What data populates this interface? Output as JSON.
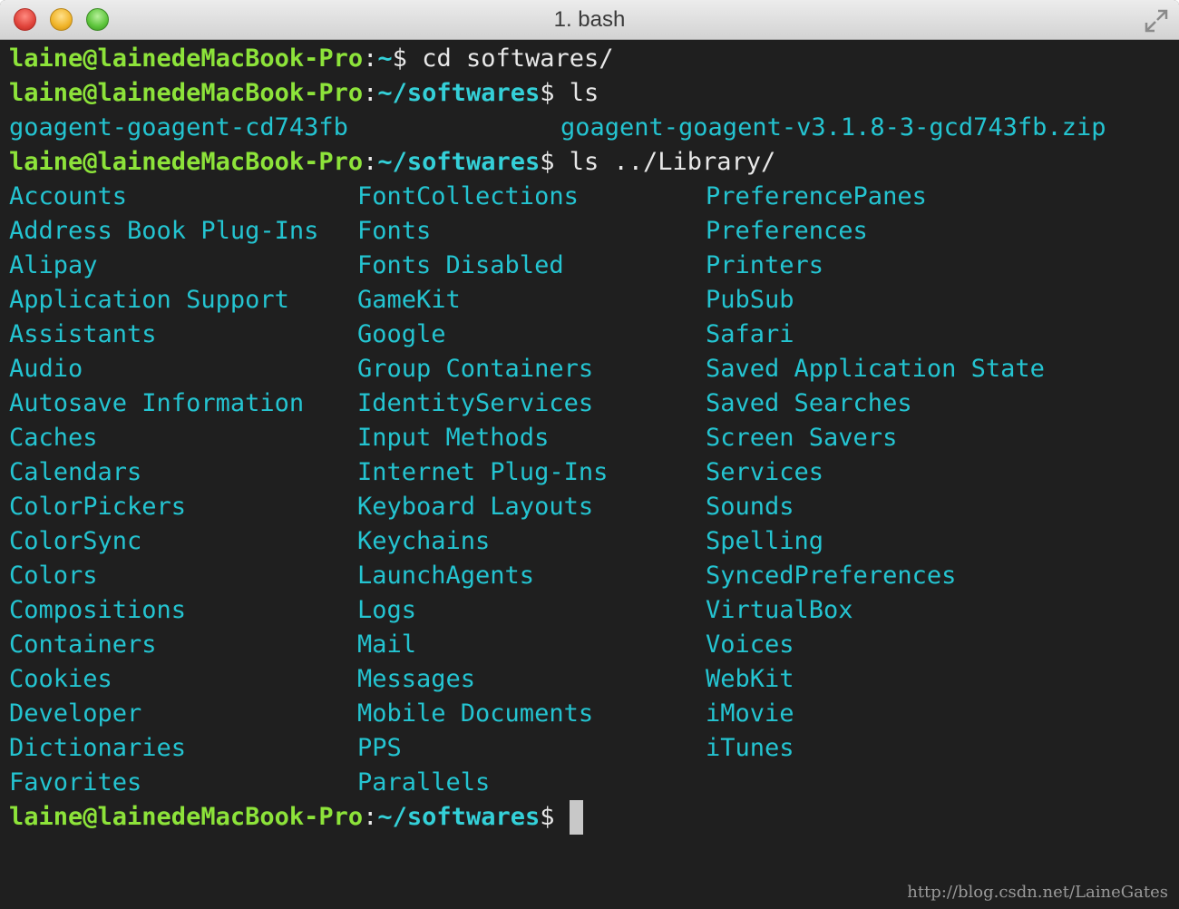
{
  "window": {
    "title": "1. bash"
  },
  "terminal": {
    "prompt_user": "laine@lainedeMacBook-Pro",
    "lines": [
      {
        "path": "~",
        "command": " cd softwares/"
      },
      {
        "path": "~/softwares",
        "command": " ls"
      },
      {
        "path": "~/softwares",
        "command": " ls ../Library/"
      },
      {
        "path": "~/softwares",
        "command": " "
      }
    ],
    "ls_softwares": {
      "dir": "goagent-goagent-cd743fb",
      "zip": "goagent-goagent-v3.1.8-3-gcd743fb.zip"
    },
    "library_columns": [
      [
        "Accounts",
        "Address Book Plug-Ins",
        "Alipay",
        "Application Support",
        "Assistants",
        "Audio",
        "Autosave Information",
        "Caches",
        "Calendars",
        "ColorPickers",
        "ColorSync",
        "Colors",
        "Compositions",
        "Containers",
        "Cookies",
        "Developer",
        "Dictionaries",
        "Favorites"
      ],
      [
        "FontCollections",
        "Fonts",
        "Fonts Disabled",
        "GameKit",
        "Google",
        "Group Containers",
        "IdentityServices",
        "Input Methods",
        "Internet Plug-Ins",
        "Keyboard Layouts",
        "Keychains",
        "LaunchAgents",
        "Logs",
        "Mail",
        "Messages",
        "Mobile Documents",
        "PPS",
        "Parallels"
      ],
      [
        "PreferencePanes",
        "Preferences",
        "Printers",
        "PubSub",
        "Safari",
        "Saved Application State",
        "Saved Searches",
        "Screen Savers",
        "Services",
        "Sounds",
        "Spelling",
        "SyncedPreferences",
        "VirtualBox",
        "Voices",
        "WebKit",
        "iMovie",
        "iTunes"
      ]
    ]
  },
  "watermark": "http://blog.csdn.net/LaineGates",
  "colors": {
    "background": "#1f1f1f",
    "user": "#8de33a",
    "path": "#34d0d8",
    "directory": "#24c4d1",
    "archive": "#d6261a"
  }
}
